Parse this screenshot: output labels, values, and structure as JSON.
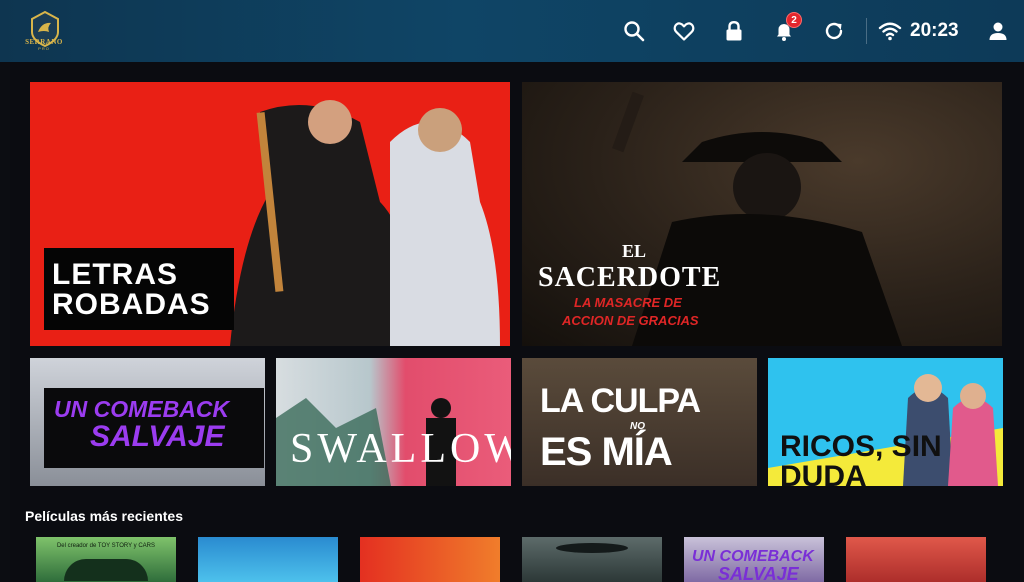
{
  "app": {
    "logo_text": "SERRANO",
    "logo_sub": "PRO",
    "accent": "#0f4566"
  },
  "topbar": {
    "icons": [
      "search-icon",
      "heart-icon",
      "lock-icon",
      "bell-icon",
      "refresh-icon",
      "wifi-icon",
      "user-icon"
    ],
    "notification_count": "2",
    "clock": "20:23",
    "badge_color": "#e3262d"
  },
  "featured": [
    {
      "title_line1": "LETRAS",
      "title_line2": "ROBADAS",
      "bg": "#e92015"
    },
    {
      "title_line1": "EL",
      "title_line2": "SACERDOTE",
      "subtitle_line1": "LA MASACRE DE",
      "subtitle_line2": "ACCION DE GRACIAS"
    }
  ],
  "tiles": [
    {
      "title_line1": "UN COMEBACK",
      "title_line2": "SALVAJE",
      "color": "#8a2be2"
    },
    {
      "title": "SWALLOW"
    },
    {
      "title_line1": "LA CULPA",
      "title_small": "NO",
      "title_line2": "ES MÍA"
    },
    {
      "title": "RICOS, SIN DUDA"
    }
  ],
  "section": {
    "title": "Películas más recientes"
  },
  "posters": [
    {
      "text": "Del creador de TOY STORY y CARS"
    },
    {
      "text": ""
    },
    {
      "text": ""
    },
    {
      "text": ""
    },
    {
      "title_line1": "UN COMEBACK",
      "title_line2": "SALVAJE"
    },
    {
      "text": ""
    }
  ]
}
